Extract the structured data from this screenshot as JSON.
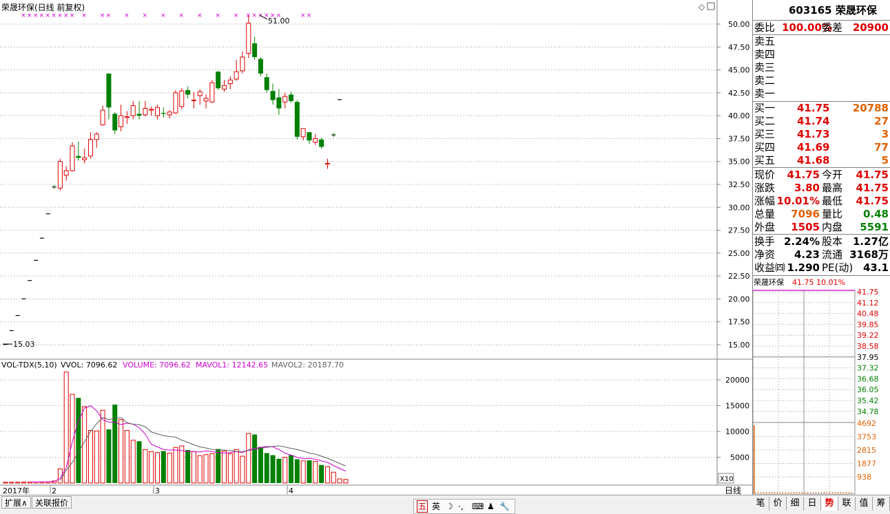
{
  "chart_title": "荣晟环保(日线 前复权)",
  "price_axis_ticks": [
    "50.00",
    "47.50",
    "45.00",
    "42.50",
    "40.00",
    "37.50",
    "35.00",
    "32.50",
    "30.00",
    "27.50",
    "25.00",
    "22.50",
    "20.00",
    "17.50",
    "15.00"
  ],
  "high_annotation": "51.00",
  "low_annotation": "15.03",
  "volume_indicator": {
    "name": "VOL-TDX(5,10)",
    "vvol": "VVOL: 7096.62",
    "volume": "VOLUME: 7096.62",
    "mavol1": "MAVOL1: 12142.65",
    "mavol2": "MAVOL2: 20187.70"
  },
  "volume_axis_ticks": [
    "20000",
    "15000",
    "10000",
    "5000"
  ],
  "volume_unit": "X10",
  "date_labels": [
    "2017年",
    "2",
    "3",
    "4"
  ],
  "period_label": "日线",
  "bottom_tabs": [
    "扩展∧",
    "关联报价"
  ],
  "ime_bar": [
    "五",
    "英",
    "☽",
    "·,",
    "⌨",
    "♟",
    "🔧"
  ],
  "quote": {
    "header": "603165 荣晟环保",
    "weibi_label": "委比",
    "weibi": "100.00%",
    "weicha_label": "委差",
    "weicha": "20900",
    "sell": [
      {
        "label": "卖五",
        "price": "",
        "vol": ""
      },
      {
        "label": "卖四",
        "price": "",
        "vol": ""
      },
      {
        "label": "卖三",
        "price": "",
        "vol": ""
      },
      {
        "label": "卖二",
        "price": "",
        "vol": ""
      },
      {
        "label": "卖一",
        "price": "",
        "vol": ""
      }
    ],
    "buy": [
      {
        "label": "买一",
        "price": "41.75",
        "vol": "20788"
      },
      {
        "label": "买二",
        "price": "41.74",
        "vol": "27"
      },
      {
        "label": "买三",
        "price": "41.73",
        "vol": "3"
      },
      {
        "label": "买四",
        "price": "41.69",
        "vol": "77"
      },
      {
        "label": "买五",
        "price": "41.68",
        "vol": "5"
      }
    ],
    "stats": [
      {
        "l1": "现价",
        "v1": "41.75",
        "l2": "今开",
        "v2": "41.75"
      },
      {
        "l1": "涨跌",
        "v1": "3.80",
        "l2": "最高",
        "v2": "41.75"
      },
      {
        "l1": "涨幅",
        "v1": "10.01%",
        "l2": "最低",
        "v2": "41.75"
      },
      {
        "l1": "总量",
        "v1": "7096",
        "l2": "量比",
        "v2": "0.48"
      },
      {
        "l1": "外盘",
        "v1": "1505",
        "l2": "内盘",
        "v2": "5591"
      }
    ],
    "finance": [
      {
        "l1": "换手",
        "v1": "2.24%",
        "l2": "股本",
        "v2": "1.27亿"
      },
      {
        "l1": "净资",
        "v1": "4.23",
        "l2": "流通",
        "v2": "3168万"
      },
      {
        "l1": "收益㈣",
        "v1": "1.290",
        "l2": "PE(动)",
        "v2": "43.1"
      }
    ],
    "mini_title": "荣晟环保",
    "mini_price": "41.75",
    "mini_pct": "10.01%",
    "mini_price_ticks": [
      "41.75",
      "41.12",
      "40.48",
      "39.85",
      "39.22",
      "38.58",
      "37.95",
      "37.32",
      "36.68",
      "36.05",
      "35.42",
      "34.78"
    ],
    "mini_vol_ticks": [
      "4692",
      "3753",
      "2815",
      "1877",
      "938"
    ],
    "tabs": [
      "笔",
      "价",
      "细",
      "日",
      "势",
      "联",
      "值",
      "筹"
    ],
    "active_tab": "势"
  },
  "chart_data": {
    "type": "candlestick",
    "title": "荣晟环保(日线 前复权)",
    "ylim": [
      13.5,
      52.5
    ],
    "candles": [
      [
        15.03,
        15.03,
        15.03,
        15.03
      ],
      [
        16.54,
        16.54,
        16.54,
        16.54
      ],
      [
        18.19,
        18.19,
        18.19,
        18.19
      ],
      [
        20.01,
        20.01,
        20.01,
        20.01
      ],
      [
        22.01,
        22.01,
        22.01,
        22.01
      ],
      [
        24.21,
        24.21,
        24.21,
        24.21
      ],
      [
        26.63,
        26.63,
        26.63,
        26.63
      ],
      [
        29.29,
        29.29,
        29.29,
        29.29
      ],
      [
        32.22,
        32.22,
        32.22,
        32.22
      ],
      [
        32.1,
        35.3,
        31.8,
        35.0
      ],
      [
        33.5,
        34.5,
        32.9,
        34.0
      ],
      [
        34.0,
        37.1,
        33.9,
        36.7
      ],
      [
        35.6,
        37.2,
        35.1,
        35.4
      ],
      [
        35.2,
        36.4,
        34.8,
        35.4
      ],
      [
        35.6,
        38.2,
        35.3,
        37.4
      ],
      [
        37.4,
        38.2,
        36.5,
        38.0
      ],
      [
        39.0,
        41.1,
        38.9,
        40.6
      ],
      [
        44.6,
        44.6,
        39.6,
        40.9
      ],
      [
        40.2,
        40.4,
        38.0,
        38.4
      ],
      [
        38.8,
        41.2,
        38.3,
        40.0
      ],
      [
        39.8,
        40.5,
        39.1,
        39.9
      ],
      [
        40.0,
        41.6,
        39.6,
        41.1
      ],
      [
        40.2,
        41.6,
        39.6,
        40.0
      ],
      [
        40.1,
        41.6,
        39.9,
        40.8
      ],
      [
        40.6,
        41.0,
        40.0,
        40.7
      ],
      [
        40.0,
        41.2,
        39.6,
        40.9
      ],
      [
        40.3,
        40.9,
        39.8,
        40.2
      ],
      [
        40.1,
        40.6,
        39.7,
        40.4
      ],
      [
        40.3,
        42.8,
        40.2,
        42.5
      ],
      [
        41.0,
        43.0,
        40.7,
        42.7
      ],
      [
        42.8,
        43.2,
        41.9,
        42.3
      ],
      [
        41.7,
        42.6,
        40.8,
        41.7
      ],
      [
        42.2,
        42.9,
        41.2,
        42.6
      ],
      [
        41.6,
        42.3,
        40.8,
        41.9
      ],
      [
        41.5,
        43.9,
        41.4,
        43.6
      ],
      [
        44.8,
        44.9,
        42.8,
        43.0
      ],
      [
        42.9,
        43.9,
        42.6,
        43.3
      ],
      [
        43.5,
        44.3,
        42.9,
        43.9
      ],
      [
        44.0,
        46.1,
        43.8,
        44.8
      ],
      [
        44.9,
        47.0,
        44.6,
        46.4
      ],
      [
        46.8,
        51.0,
        46.3,
        50.1
      ],
      [
        47.9,
        48.6,
        46.1,
        46.4
      ],
      [
        46.2,
        46.4,
        44.3,
        44.6
      ],
      [
        44.2,
        44.6,
        42.5,
        42.8
      ],
      [
        42.7,
        43.5,
        41.2,
        41.7
      ],
      [
        42.0,
        42.9,
        40.1,
        40.8
      ],
      [
        41.5,
        42.5,
        40.8,
        42.1
      ],
      [
        42.3,
        42.6,
        41.4,
        41.6
      ],
      [
        41.5,
        41.7,
        37.4,
        37.7
      ],
      [
        37.7,
        38.6,
        37.3,
        38.6
      ],
      [
        38.2,
        38.2,
        36.9,
        37.3
      ],
      [
        37.1,
        38.0,
        36.8,
        37.5
      ],
      [
        37.4,
        37.6,
        36.4,
        36.6
      ],
      [
        34.8,
        35.3,
        34.2,
        34.8
      ],
      [
        37.9,
        37.9,
        37.9,
        37.9
      ],
      [
        41.75,
        41.75,
        41.75,
        41.75
      ]
    ],
    "volumes": [
      150,
      160,
      170,
      180,
      190,
      200,
      210,
      230,
      400,
      2750,
      21500,
      17200,
      16500,
      14800,
      10200,
      10100,
      14100,
      10400,
      15200,
      12300,
      10200,
      8300,
      8100,
      6500,
      6100,
      5900,
      6200,
      5800,
      6900,
      7200,
      6400,
      6100,
      5300,
      5500,
      5700,
      6600,
      6200,
      5700,
      6500,
      5200,
      9600,
      9400,
      7000,
      5800,
      5400,
      4700,
      5000,
      5400,
      4600,
      4300,
      4400,
      4200,
      3500,
      3200,
      2100,
      800,
      700
    ],
    "mavol1": [
      null,
      null,
      null,
      null,
      190,
      200,
      210,
      230,
      280,
      900,
      3000,
      8000,
      12000,
      14500,
      15000,
      14000,
      12300,
      11800,
      11800,
      11300,
      11600,
      11400,
      10700,
      9500,
      7500,
      7000,
      6500,
      6400,
      6400,
      6300,
      6100,
      6100,
      6000,
      6200,
      6100,
      5900,
      5800,
      5900,
      6100,
      5900,
      6400,
      6700,
      6900,
      7100,
      7000,
      6500,
      5800,
      5400,
      5000,
      4700,
      4800,
      4600,
      4300,
      4000,
      3400,
      2800,
      2300
    ],
    "mavol2": [
      null,
      null,
      null,
      null,
      null,
      null,
      null,
      null,
      null,
      500,
      2500,
      4000,
      6000,
      8000,
      10000,
      11500,
      12700,
      12300,
      12500,
      12700,
      11700,
      11400,
      11300,
      10900,
      9900,
      9500,
      9200,
      9000,
      8900,
      8300,
      7900,
      7400,
      7000,
      6800,
      6500,
      6400,
      6400,
      6300,
      6100,
      6100,
      6300,
      6500,
      6800,
      6900,
      7100,
      7200,
      7000,
      6700,
      6500,
      6200,
      5800,
      5600,
      5200,
      4800,
      4300,
      3800,
      3300
    ],
    "markers_x": [
      0,
      1,
      2,
      3,
      4,
      5,
      6,
      7,
      8,
      10,
      13,
      14,
      17,
      20,
      23,
      26,
      29,
      32,
      35,
      37,
      38,
      39,
      40,
      41,
      42,
      46,
      47
    ]
  }
}
